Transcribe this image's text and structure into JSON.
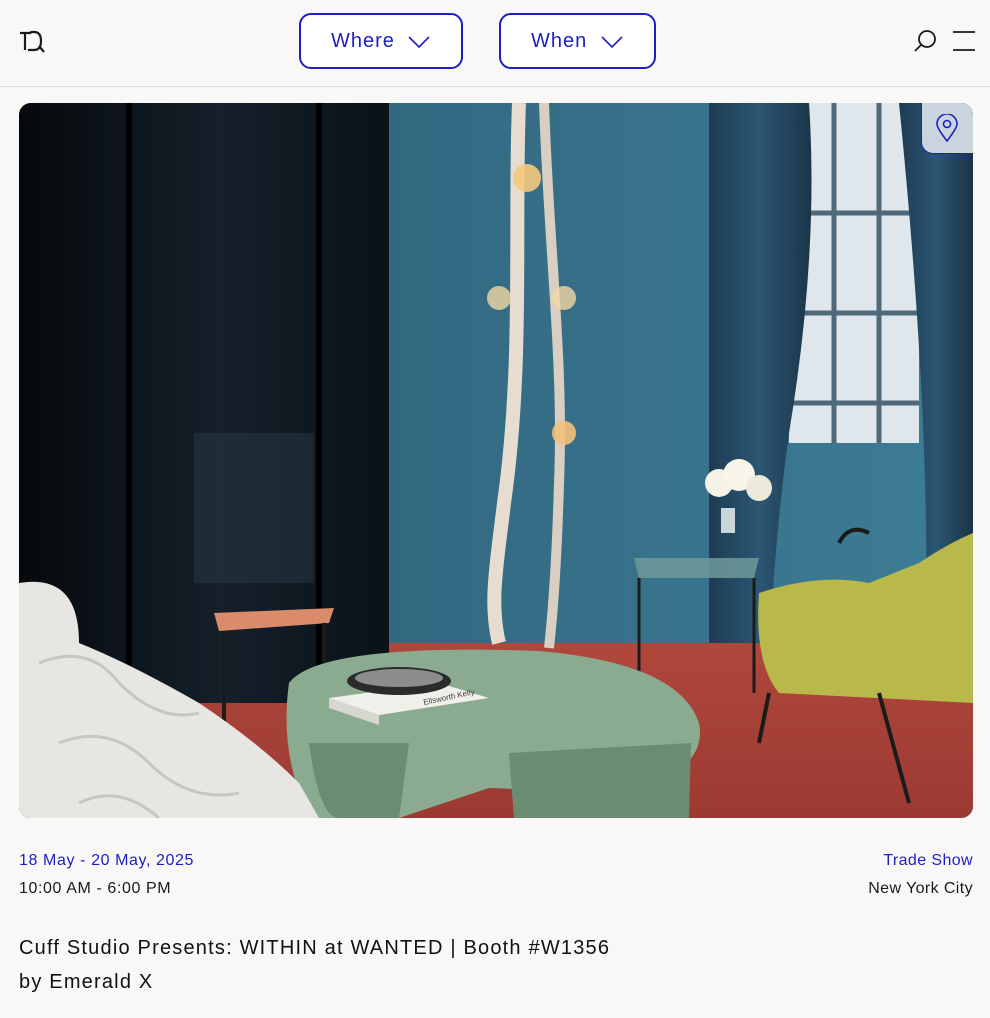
{
  "header": {
    "logo_icon": "monogram-logo",
    "filters": [
      {
        "label": "Where",
        "icon": "chevron-down-icon"
      },
      {
        "label": "When",
        "icon": "chevron-down-icon"
      }
    ],
    "search_icon": "search-icon",
    "menu_icon": "hamburger-menu-icon",
    "accent_color": "#1c1fc4"
  },
  "event": {
    "image_alt": "Interior with blue walls, rope pendant lights, green coffee table and red carpet",
    "map_pin_icon": "map-pin-icon",
    "date_range": "18 May - 20 May, 2025",
    "time_range": "10:00 AM - 6:00 PM",
    "category": "Trade Show",
    "city": "New York City",
    "title": "Cuff Studio Presents: WITHIN at WANTED | Booth #W1356",
    "byline": "by Emerald X",
    "book_label": "Ellsworth Kelly"
  }
}
